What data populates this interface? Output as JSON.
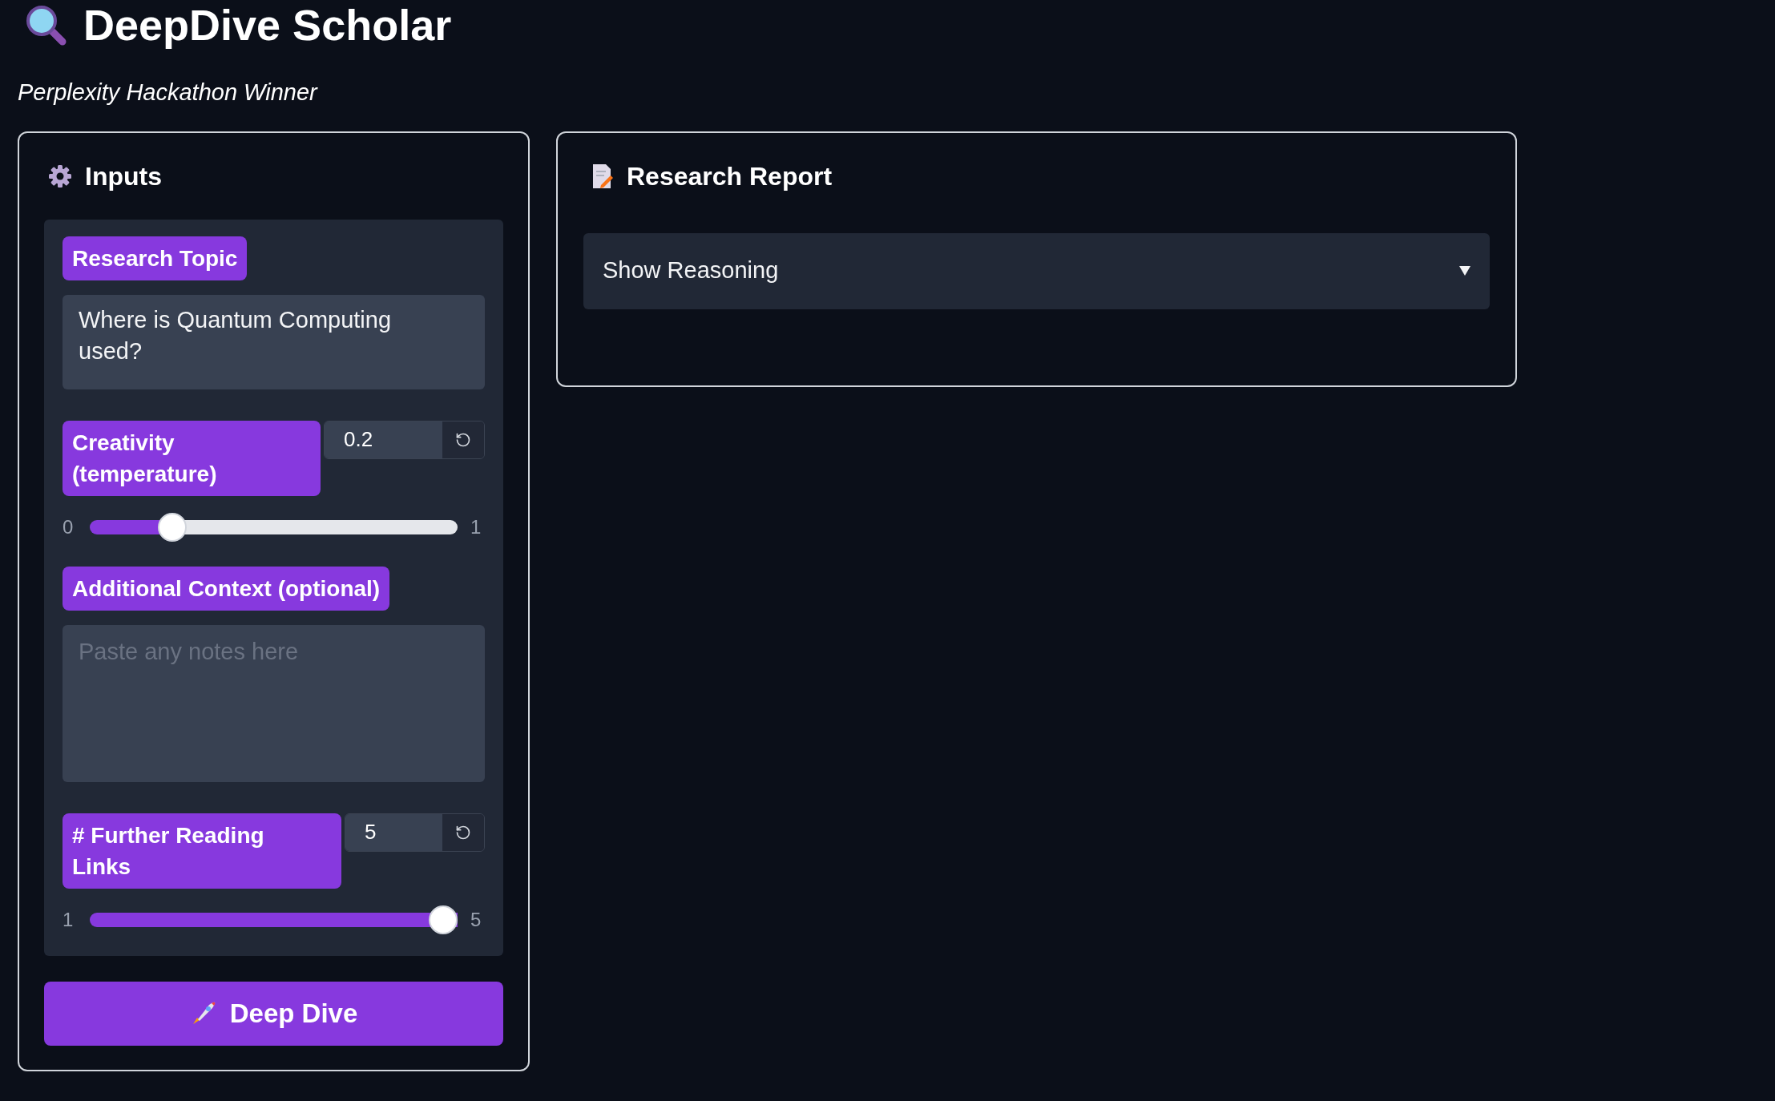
{
  "header": {
    "title": "DeepDive Scholar",
    "subtitle": "Perplexity Hackathon Winner"
  },
  "inputs_panel": {
    "title": "Inputs",
    "topic": {
      "label": "Research Topic",
      "value": "Where is Quantum Computing used?"
    },
    "creativity": {
      "label": "Creativity (temperature)",
      "value": "0.2",
      "min": "0",
      "max": "1",
      "level": 0.2
    },
    "context": {
      "label": "Additional Context (optional)",
      "placeholder": "Paste any notes here"
    },
    "links": {
      "label": "# Further Reading Links",
      "value": "5",
      "min": "1",
      "max": "5",
      "level": 1
    },
    "button": "Deep Dive"
  },
  "report_panel": {
    "title": "Research Report",
    "accordion": {
      "label": "Show Reasoning",
      "expanded": false
    }
  }
}
